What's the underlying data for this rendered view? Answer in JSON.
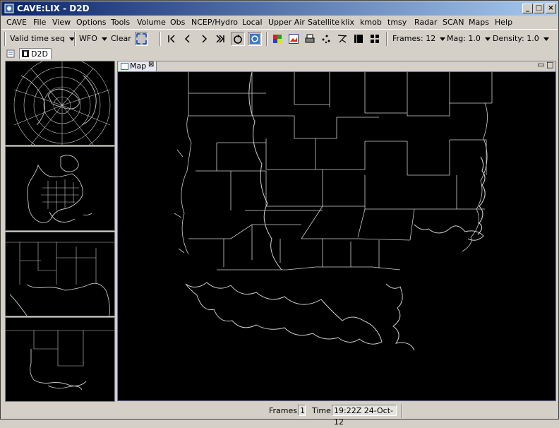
{
  "window": {
    "title": "CAVE:LIX - D2D"
  },
  "menu": [
    "CAVE",
    "File",
    "View",
    "Options",
    "Tools",
    "Volume",
    "Obs",
    "NCEP/Hydro",
    "Local",
    "Upper Air",
    "Satellite",
    "klix",
    "kmob",
    "tmsy",
    "Radar",
    "SCAN",
    "Maps",
    "Help"
  ],
  "toolbar": {
    "time_mode": "Valid time seq",
    "scale": "WFO",
    "clear": "Clear",
    "frames": "Frames: 12",
    "mag": "Mag: 1.0",
    "density": "Density: 1.0"
  },
  "tabs": {
    "d2d": "D2D",
    "map": "Map"
  },
  "status": {
    "frames_label": "Frames:",
    "frames_value": "1",
    "time_label": "Time:",
    "time_value": "19:22Z 24-Oct-12"
  }
}
